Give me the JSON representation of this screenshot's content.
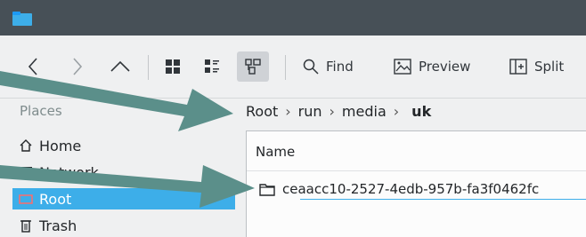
{
  "toolbar": {
    "back_label": "<",
    "forward_label": ">",
    "up_label": "^",
    "find_label": "Find",
    "preview_label": "Preview",
    "split_label": "Split"
  },
  "sidebar": {
    "header": "Places",
    "items": [
      {
        "label": "Home",
        "icon": "home-icon"
      },
      {
        "label": "Network",
        "icon": "network-icon"
      },
      {
        "label": "Root",
        "icon": "drive-icon",
        "active": true
      },
      {
        "label": "Trash",
        "icon": "trash-icon"
      }
    ]
  },
  "breadcrumb": {
    "items": [
      "Root",
      "run",
      "media"
    ],
    "current": "uk"
  },
  "file_view": {
    "column_header": "Name",
    "rows": [
      {
        "name": "ceaacc10-2527-4edb-957b-fa3f0462fc",
        "icon": "folder-icon"
      }
    ]
  },
  "colors": {
    "titlebar": "#475057",
    "accent": "#3daee9",
    "annotation_arrow": "#5b8f8a"
  }
}
